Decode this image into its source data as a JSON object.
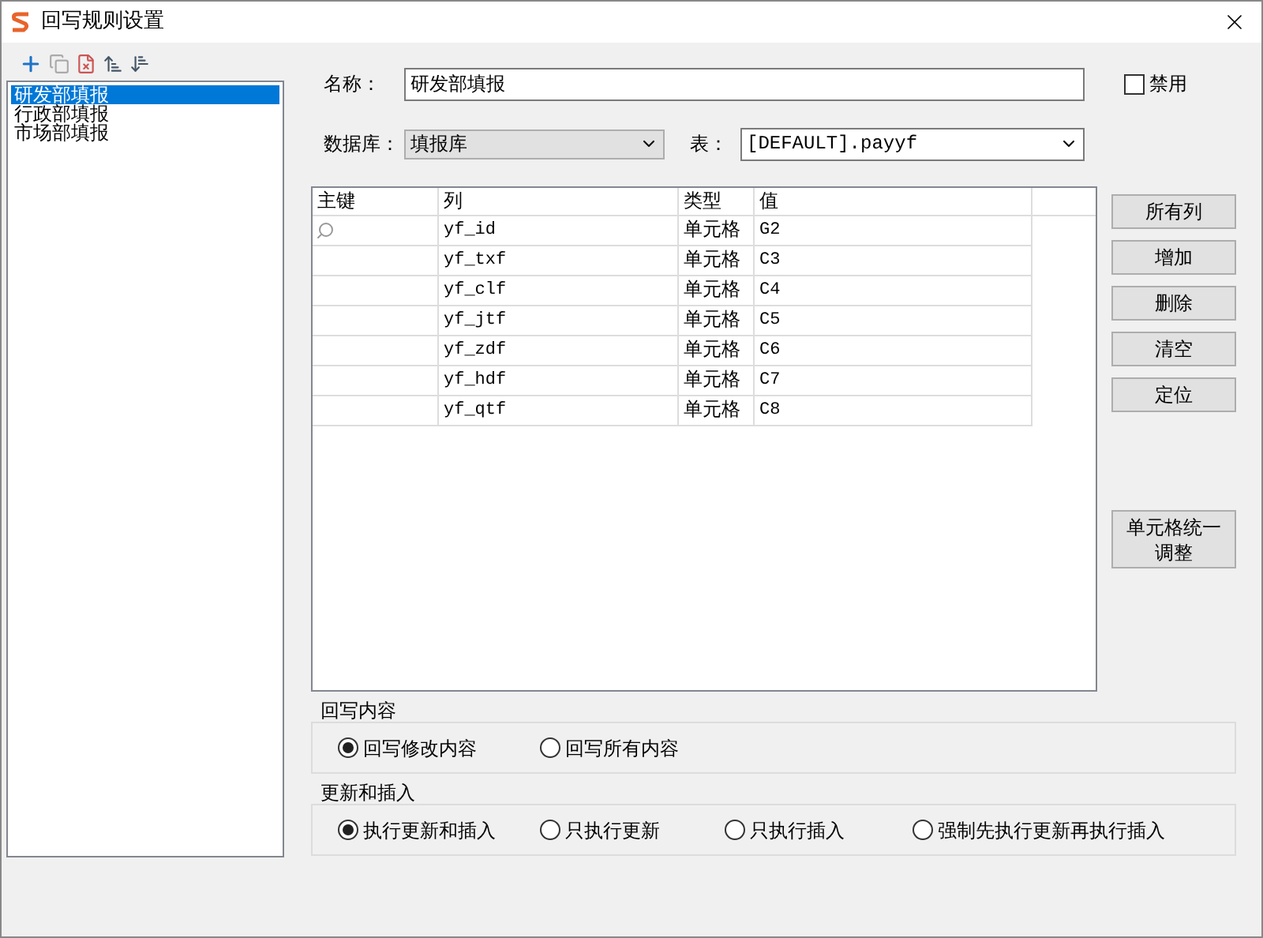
{
  "window": {
    "title": "回写规则设置"
  },
  "rules": [
    {
      "label": "研发部填报",
      "selected": true
    },
    {
      "label": "行政部填报",
      "selected": false
    },
    {
      "label": "市场部填报",
      "selected": false
    }
  ],
  "form": {
    "name_label": "名称：",
    "name_value": "研发部填报",
    "disabled": {
      "label": "禁用",
      "checked": false
    },
    "database_label": "数据库：",
    "database_value": "填报库",
    "table_label": "表：",
    "table_value": "[DEFAULT].payyf"
  },
  "grid": {
    "columns": [
      "主键",
      "列",
      "类型",
      "值"
    ],
    "rows": [
      {
        "primary_key": true,
        "column": "yf_id",
        "type": "单元格",
        "value": "G2"
      },
      {
        "primary_key": false,
        "column": "yf_txf",
        "type": "单元格",
        "value": "C3"
      },
      {
        "primary_key": false,
        "column": "yf_clf",
        "type": "单元格",
        "value": "C4"
      },
      {
        "primary_key": false,
        "column": "yf_jtf",
        "type": "单元格",
        "value": "C5"
      },
      {
        "primary_key": false,
        "column": "yf_zdf",
        "type": "单元格",
        "value": "C6"
      },
      {
        "primary_key": false,
        "column": "yf_hdf",
        "type": "单元格",
        "value": "C7"
      },
      {
        "primary_key": false,
        "column": "yf_qtf",
        "type": "单元格",
        "value": "C8"
      }
    ]
  },
  "side_buttons": [
    "所有列",
    "增加",
    "删除",
    "清空",
    "定位"
  ],
  "adjust_button": "单元格统一调整",
  "groups": [
    {
      "title": "回写内容",
      "options": [
        {
          "label": "回写修改内容",
          "selected": true
        },
        {
          "label": "回写所有内容",
          "selected": false
        }
      ]
    },
    {
      "title": "更新和插入",
      "options": [
        {
          "label": "执行更新和插入",
          "selected": true
        },
        {
          "label": "只执行更新",
          "selected": false
        },
        {
          "label": "只执行插入",
          "selected": false
        },
        {
          "label": "强制先执行更新再执行插入",
          "selected": false
        }
      ]
    }
  ]
}
